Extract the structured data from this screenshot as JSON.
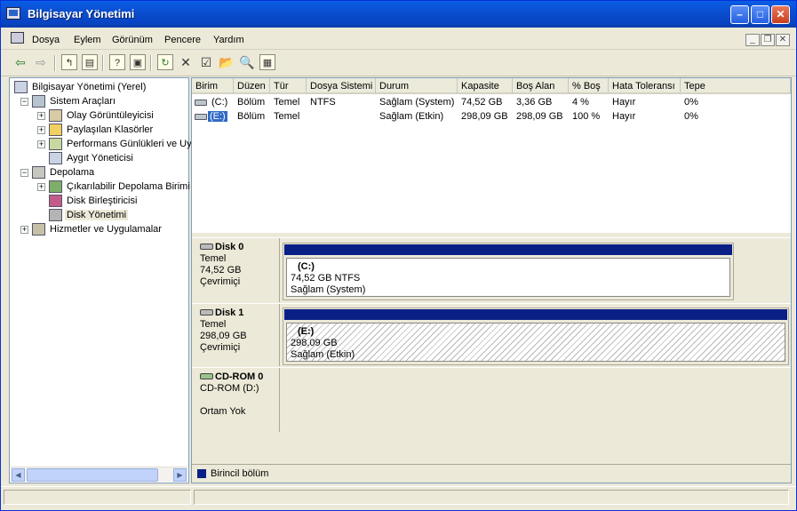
{
  "window": {
    "title": "Bilgisayar Yönetimi",
    "min_glyph": "–",
    "max_glyph": "□",
    "close_glyph": "✕"
  },
  "menu": {
    "items": [
      "Dosya",
      "Eylem",
      "Görünüm",
      "Pencere",
      "Yardım"
    ],
    "mdi_min": "_",
    "mdi_restore": "❐",
    "mdi_close": "✕"
  },
  "toolbar": {
    "back_glyph": "⇦",
    "forward_glyph": "⇨",
    "up_glyph": "↰",
    "show_tree_glyph": "▤",
    "help_glyph": "?",
    "console_glyph": "▣",
    "refresh_glyph": "↻",
    "delete_glyph": "✕",
    "properties_glyph": "☑",
    "open_glyph": "📂",
    "search_glyph": "🔍",
    "help2_glyph": "▦"
  },
  "tree": {
    "root": "Bilgisayar Yönetimi (Yerel)",
    "system_tools": "Sistem Araçları",
    "event_viewer": "Olay Görüntüleyicisi",
    "shared_folders": "Paylaşılan Klasörler",
    "performance": "Performans Günlükleri ve Uy",
    "device_manager": "Aygıt Yöneticisi",
    "storage": "Depolama",
    "removable_storage": "Çıkarılabilir Depolama Birimi",
    "defragmenter": "Disk Birleştiricisi",
    "disk_management": "Disk Yönetimi",
    "services_apps": "Hizmetler ve Uygulamalar",
    "expanded_glyph": "−",
    "collapsed_glyph": "+"
  },
  "volume_list": {
    "headers": [
      "Birim",
      "Düzen",
      "Tür",
      "Dosya Sistemi",
      "Durum",
      "Kapasite",
      "Boş Alan",
      "% Boş",
      "Hata Toleransı",
      "Tepe"
    ],
    "rows": [
      {
        "volume": "(C:)",
        "layout": "Bölüm",
        "type": "Temel",
        "fs": "NTFS",
        "status": "Sağlam (System)",
        "capacity": "74,52 GB",
        "free": "3,36 GB",
        "pct_free": "4 %",
        "fault_tolerance": "Hayır",
        "overhead": "0%"
      },
      {
        "volume": "(E:)",
        "layout": "Bölüm",
        "type": "Temel",
        "fs": "",
        "status": "Sağlam (Etkin)",
        "capacity": "298,09 GB",
        "free": "298,09 GB",
        "pct_free": "100 %",
        "fault_tolerance": "Hayır",
        "overhead": "0%"
      }
    ]
  },
  "disks": [
    {
      "name": "Disk 0",
      "type": "Temel",
      "size": "74,52 GB",
      "state": "Çevrimiçi",
      "partition": {
        "label": "(C:)",
        "size_fs": "74,52 GB NTFS",
        "status": "Sağlam (System)"
      }
    },
    {
      "name": "Disk 1",
      "type": "Temel",
      "size": "298,09 GB",
      "state": "Çevrimiçi",
      "partition": {
        "label": "(E:)",
        "size_fs": "298,09 GB",
        "status": "Sağlam (Etkin)"
      }
    },
    {
      "name": "CD-ROM 0",
      "type": "CD-ROM (D:)",
      "size": "",
      "state": "Ortam Yok"
    }
  ],
  "legend": {
    "primary_partition": "Birincil bölüm",
    "primary_color": "#0a1f86"
  },
  "colors": {
    "titlebar": "#0b4fd0",
    "selection": "#316ac5",
    "partition_bar": "#0a1f86"
  }
}
